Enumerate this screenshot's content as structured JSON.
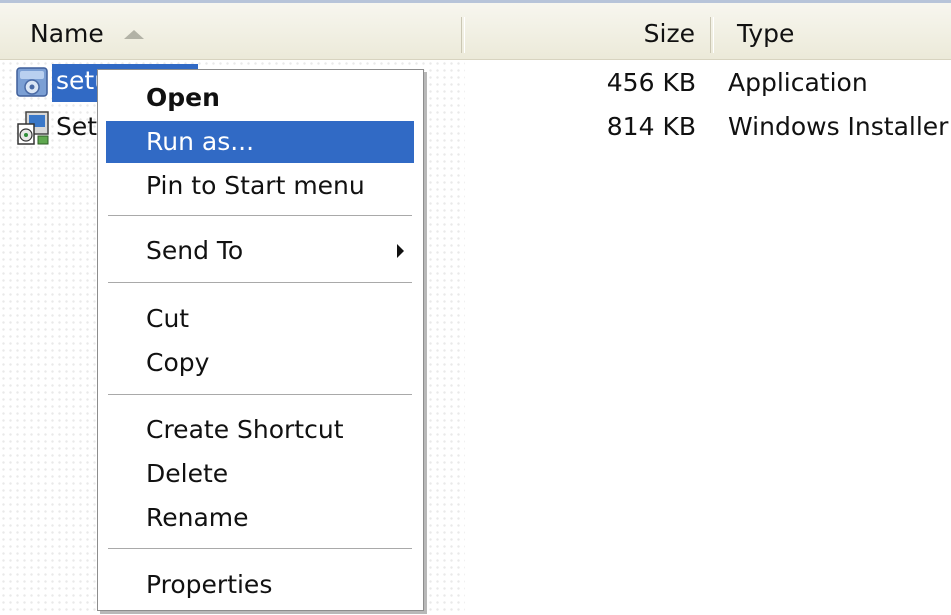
{
  "header": {
    "name": "Name",
    "size": "Size",
    "type": "Type"
  },
  "files": [
    {
      "name": "setup",
      "size": "456 KB",
      "type": "Application",
      "icon": "application-setup-icon"
    },
    {
      "name": "Setup",
      "size": "814 KB",
      "type": "Windows Installer",
      "icon": "windows-installer-package-icon"
    }
  ],
  "context_menu": {
    "items": {
      "open": "Open",
      "run_as": "Run as...",
      "pin_start": "Pin to Start menu",
      "send_to": "Send To",
      "cut": "Cut",
      "copy": "Copy",
      "create_shortcut": "Create Shortcut",
      "delete": "Delete",
      "rename": "Rename",
      "properties": "Properties"
    },
    "default_item": "open",
    "highlighted_item": "run_as"
  },
  "colors": {
    "selection": "#316ac5",
    "header_bg": "#ecead9",
    "menu_border": "#8d8d8d"
  }
}
